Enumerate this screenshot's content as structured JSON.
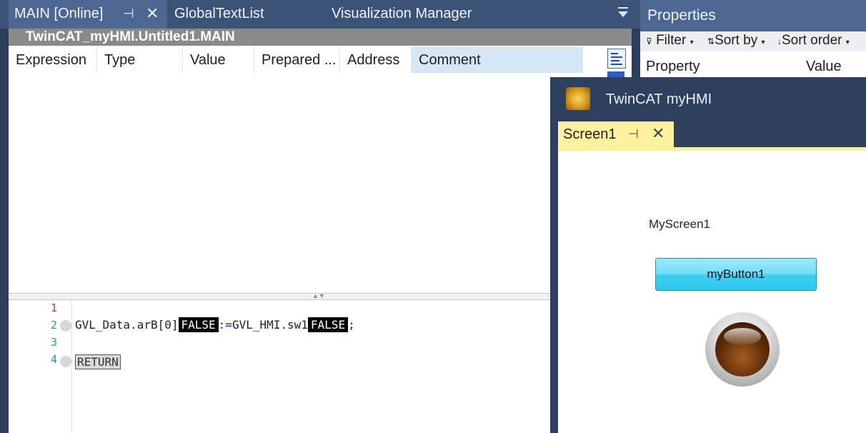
{
  "tabs": {
    "main_tab": "MAIN [Online]",
    "global_text_list": "GlobalTextList",
    "visualization_manager": "Visualization Manager"
  },
  "editor": {
    "pou_title": "TwinCAT_myHMI.Untitled1.MAIN",
    "columns": [
      "Expression",
      "Type",
      "Value",
      "Prepared ...",
      "Address",
      "Comment"
    ],
    "lines": [
      {
        "num": "1"
      },
      {
        "num": "2",
        "lhs": "GVL_Data",
        "dot1": ".",
        "member1": "arB[0]",
        "lhs_value": "FALSE",
        "assign": ":=",
        "rhs": "GVL_HMI",
        "dot2": ".",
        "member2": "sw1",
        "rhs_value": "FALSE",
        "semi": ";"
      },
      {
        "num": "3"
      },
      {
        "num": "4",
        "keyword": "RETURN"
      }
    ]
  },
  "properties": {
    "title": "Properties",
    "filter_label": "Filter",
    "sort_by_label": "Sort by",
    "sort_order_label": "Sort order",
    "col_property": "Property",
    "col_value": "Value"
  },
  "hmi": {
    "window_title": "TwinCAT myHMI",
    "screen_tab": "Screen1",
    "screen_label": "MyScreen1",
    "button_label": "myButton1"
  }
}
